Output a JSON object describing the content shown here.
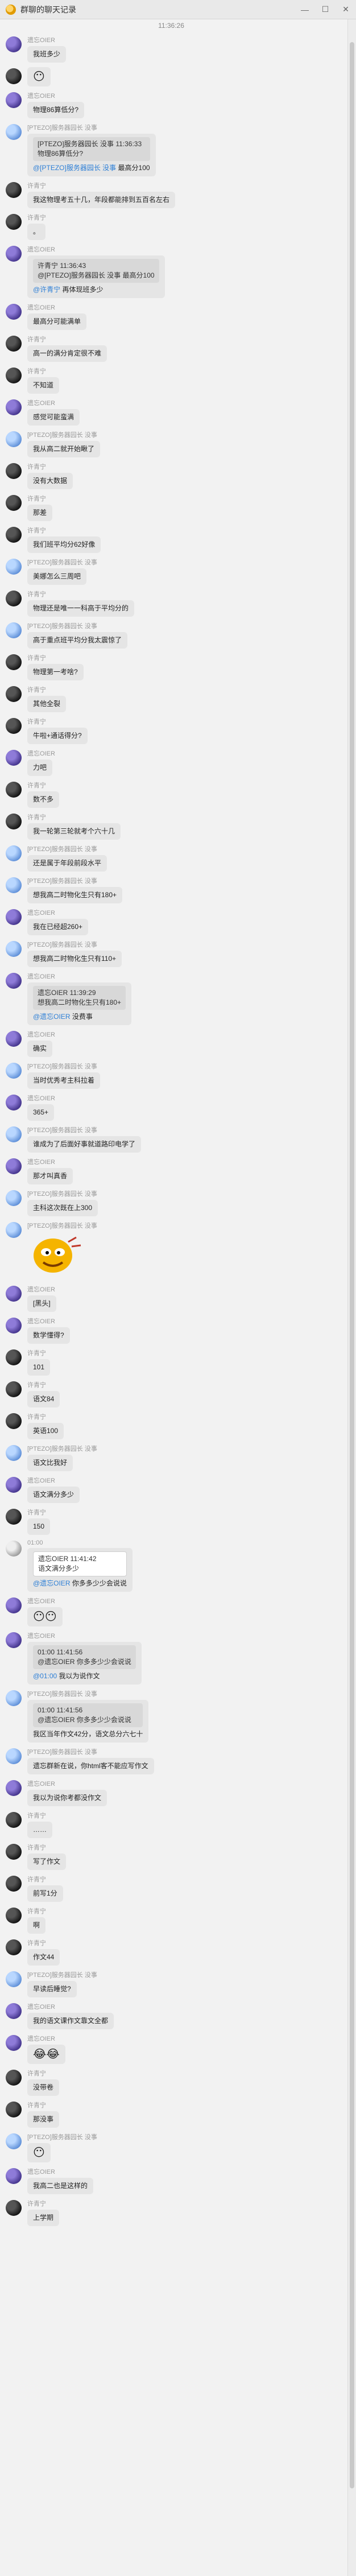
{
  "window": {
    "title": "群聊的聊天记录"
  },
  "time_divider": "11:36:26",
  "messages": [
    {
      "sender": "遗忘OIER",
      "text": "我班多少",
      "av": "a"
    },
    {
      "sender": "",
      "text": "😶",
      "av": "b",
      "emoji": true
    },
    {
      "sender": "遗忘OIER",
      "text": "物理86算低分?",
      "av": "a"
    },
    {
      "sender": "[PTEZO]服务器园长 没事",
      "quote_title": "[PTEZO]服务器园长 没事  11:36:33",
      "quote": "物理86算低分?",
      "mention": "@[PTEZO]服务器园长 没事",
      "after": " 最高分100",
      "av": "c"
    },
    {
      "sender": "许青宁",
      "text": "我这物理考五十几，年段都能排到五百名左右",
      "av": "b"
    },
    {
      "sender": "许青宁",
      "text": "。",
      "av": "b"
    },
    {
      "sender": "遗忘OIER",
      "quote_title": "许青宁  11:36:43",
      "quote": "@[PTEZO]服务器园长 没事 最高分100",
      "mention": "@许青宁",
      "after": " 再体现班多少",
      "av": "a"
    },
    {
      "sender": "遗忘OIER",
      "text": "最高分可能满单",
      "av": "a"
    },
    {
      "sender": "许青宁",
      "text": "高一的满分肯定很不难",
      "av": "b"
    },
    {
      "sender": "许青宁",
      "text": "不知道",
      "av": "b"
    },
    {
      "sender": "遗忘OIER",
      "text": "感觉可能蛮满",
      "av": "a"
    },
    {
      "sender": "[PTEZO]服务器园长 没事",
      "text": "我从高二就开始瞅了",
      "av": "c"
    },
    {
      "sender": "许青宁",
      "text": "没有大数据",
      "av": "b"
    },
    {
      "sender": "许青宁",
      "text": "那差",
      "av": "b"
    },
    {
      "sender": "许青宁",
      "text": "我们班平均分62好像",
      "av": "b"
    },
    {
      "sender": "[PTEZO]服务器园长 没事",
      "text": "美娜怎么三周吧",
      "av": "c"
    },
    {
      "sender": "许青宁",
      "text": "物理还是唯一一科高于平均分的",
      "av": "b"
    },
    {
      "sender": "[PTEZO]服务器园长 没事",
      "text": "高于重点班平均分我太震惊了",
      "av": "c"
    },
    {
      "sender": "许青宁",
      "text": "物理第一考啥?",
      "av": "b"
    },
    {
      "sender": "许青宁",
      "text": "其他全裂",
      "av": "b"
    },
    {
      "sender": "许青宁",
      "text": "牛啦+通话得分?",
      "av": "b"
    },
    {
      "sender": "遗忘OIER",
      "text": "力吧",
      "av": "a"
    },
    {
      "sender": "许青宁",
      "text": "数不多",
      "av": "b"
    },
    {
      "sender": "许青宁",
      "text": "我一轮第三轮就考个六十几",
      "av": "b"
    },
    {
      "sender": "[PTEZO]服务器园长 没事",
      "text": "还是属于年段前段水平",
      "av": "c"
    },
    {
      "sender": "[PTEZO]服务器园长 没事",
      "text": "想我高二时物化生只有180+",
      "av": "c"
    },
    {
      "sender": "遗忘OIER",
      "text": "我在已经超260+",
      "av": "a"
    },
    {
      "sender": "[PTEZO]服务器园长 没事",
      "text": "想我高二时物化生只有110+",
      "av": "c"
    },
    {
      "sender": "遗忘OIER",
      "quote_title": "遗忘OIER  11:39:29",
      "quote": "想我高二时物化生只有180+",
      "mention": "@遗忘OIER",
      "after": " 没费事",
      "av": "a"
    },
    {
      "sender": "遗忘OIER",
      "text": "确实",
      "av": "a"
    },
    {
      "sender": "[PTEZO]服务器园长 没事",
      "text": "当时优秀考主科拉着",
      "av": "c"
    },
    {
      "sender": "遗忘OIER",
      "text": "365+",
      "av": "a"
    },
    {
      "sender": "[PTEZO]服务器园长 没事",
      "text": "谁成为了后面好事就道路印电学了",
      "av": "c"
    },
    {
      "sender": "遗忘OIER",
      "text": "那才叫真香",
      "av": "a"
    },
    {
      "sender": "[PTEZO]服务器园长 没事",
      "text": "主科这次既在上300",
      "av": "c"
    },
    {
      "sender": "[PTEZO]服务器园长 没事",
      "av": "c",
      "sticker": true
    },
    {
      "sender": "遗忘OIER",
      "text": "[黑头]",
      "av": "a"
    },
    {
      "sender": "遗忘OIER",
      "text": "数学懂得?",
      "av": "a"
    },
    {
      "sender": "许青宁",
      "text": "101",
      "av": "b"
    },
    {
      "sender": "许青宁",
      "text": "语文84",
      "av": "b"
    },
    {
      "sender": "许青宁",
      "text": "英语100",
      "av": "b"
    },
    {
      "sender": "[PTEZO]服务器园长 没事",
      "text": "语文比我好",
      "av": "c"
    },
    {
      "sender": "遗忘OIER",
      "text": "语文满分多少",
      "av": "a"
    },
    {
      "sender": "许青宁",
      "text": "150",
      "av": "b"
    },
    {
      "sender": "01:00",
      "quote_title": "遗忘OIER  11:41:42",
      "quote": "语文满分多少",
      "mention": "@遗忘OIER",
      "after": " 你多多少少会说说",
      "av": "d",
      "card": true
    },
    {
      "sender": "遗忘OIER",
      "text": "😶😶",
      "av": "a",
      "emoji": true
    },
    {
      "sender": "遗忘OIER",
      "quote_title": "01:00  11:41:56",
      "quote": "@遗忘OIER 你多多少少会说说",
      "mention": "@01:00",
      "after": " 我以为说作文",
      "av": "a"
    },
    {
      "sender": "[PTEZO]服务器园长 没事",
      "quote_title": "01:00  11:41:56",
      "quote": "@遗忘OIER 你多多少少会说说",
      "plain_after": "我区当年作文42分，语文总分六七十",
      "av": "c"
    },
    {
      "sender": "[PTEZO]服务器园长 没事",
      "text": "遗忘群新在说，你html客不能应写作文",
      "av": "c"
    },
    {
      "sender": "遗忘OIER",
      "text": "我以为说你考都没作文",
      "av": "a"
    },
    {
      "sender": "许青宁",
      "text": "……",
      "av": "b"
    },
    {
      "sender": "许青宁",
      "text": "写了作文",
      "av": "b"
    },
    {
      "sender": "许青宁",
      "text": "前写1分",
      "av": "b"
    },
    {
      "sender": "许青宁",
      "text": "啊",
      "av": "b"
    },
    {
      "sender": "许青宁",
      "text": "作文44",
      "av": "b"
    },
    {
      "sender": "[PTEZO]服务器园长 没事",
      "text": "早读后睡觉?",
      "av": "c"
    },
    {
      "sender": "遗忘OIER",
      "text": "我的语文课作文靠文全都",
      "av": "a"
    },
    {
      "sender": "遗忘OIER",
      "text": "😂😂",
      "av": "a",
      "emoji": true
    },
    {
      "sender": "许青宁",
      "text": "没带卷",
      "av": "b"
    },
    {
      "sender": "许青宁",
      "text": "那没事",
      "av": "b"
    },
    {
      "sender": "[PTEZO]服务器园长 没事",
      "text": "😶",
      "av": "c",
      "emoji": true
    },
    {
      "sender": "遗忘OIER",
      "text": "我高二也是这样的",
      "av": "a"
    },
    {
      "sender": "许青宁",
      "text": "上学期",
      "av": "b"
    }
  ]
}
